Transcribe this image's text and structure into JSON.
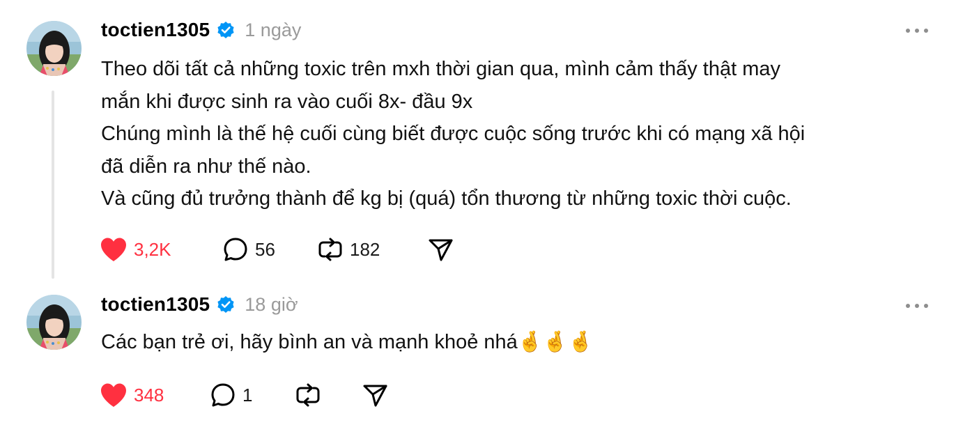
{
  "accent_like_color": "#ff3040",
  "verified_color": "#0095f6",
  "posts": [
    {
      "username": "toctien1305",
      "verified_icon": "verified-badge-icon",
      "time": "1 ngày",
      "lines": [
        "Theo dõi tất cả những toxic trên mxh thời gian qua, mình cảm thấy thật may",
        "mắn khi được sinh ra vào cuối 8x- đầu 9x",
        "Chúng mình là thế hệ cuối cùng biết được cuộc sống trước khi có mạng xã hội",
        "đã diễn ra như thế nào.",
        "Và cũng đủ trưởng thành để kg bị (quá) tổn thương từ những toxic thời cuộc."
      ],
      "likes": "3,2K",
      "comments": "56",
      "reposts": "182"
    },
    {
      "username": "toctien1305",
      "verified_icon": "verified-badge-icon",
      "time": "18 giờ",
      "lines": [
        "Các bạn trẻ ơi, hãy bình an và mạnh khoẻ nhá🤞🤞🤞"
      ],
      "likes": "348",
      "comments": "1",
      "reposts": ""
    }
  ]
}
